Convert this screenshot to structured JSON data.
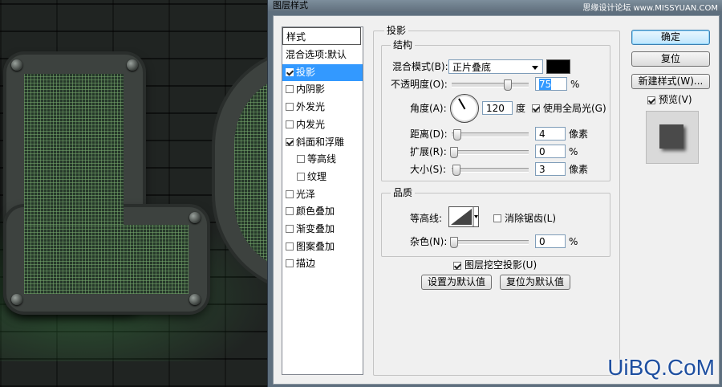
{
  "window": {
    "title": "图层样式",
    "watermark": "思缘设计论坛 www.MISSYUAN.COM"
  },
  "style_list": {
    "header": "样式",
    "items": [
      {
        "label": "混合选项:默认",
        "checkbox": false,
        "checked": false,
        "selected": false,
        "indent": 0
      },
      {
        "label": "投影",
        "checkbox": true,
        "checked": true,
        "selected": true,
        "indent": 0
      },
      {
        "label": "内阴影",
        "checkbox": true,
        "checked": false,
        "selected": false,
        "indent": 0
      },
      {
        "label": "外发光",
        "checkbox": true,
        "checked": false,
        "selected": false,
        "indent": 0
      },
      {
        "label": "内发光",
        "checkbox": true,
        "checked": false,
        "selected": false,
        "indent": 0
      },
      {
        "label": "斜面和浮雕",
        "checkbox": true,
        "checked": true,
        "selected": false,
        "indent": 0
      },
      {
        "label": "等高线",
        "checkbox": true,
        "checked": false,
        "selected": false,
        "indent": 1
      },
      {
        "label": "纹理",
        "checkbox": true,
        "checked": false,
        "selected": false,
        "indent": 1
      },
      {
        "label": "光泽",
        "checkbox": true,
        "checked": false,
        "selected": false,
        "indent": 0
      },
      {
        "label": "颜色叠加",
        "checkbox": true,
        "checked": false,
        "selected": false,
        "indent": 0
      },
      {
        "label": "渐变叠加",
        "checkbox": true,
        "checked": false,
        "selected": false,
        "indent": 0
      },
      {
        "label": "图案叠加",
        "checkbox": true,
        "checked": false,
        "selected": false,
        "indent": 0
      },
      {
        "label": "描边",
        "checkbox": true,
        "checked": false,
        "selected": false,
        "indent": 0
      }
    ]
  },
  "drop_shadow": {
    "section_title": "投影",
    "structure": {
      "title": "结构",
      "blend_mode_label": "混合模式(B):",
      "blend_mode_value": "正片叠底",
      "shadow_color": "#000000",
      "opacity_label": "不透明度(O):",
      "opacity_value": "75",
      "opacity_fraction": 0.75,
      "percent": "%",
      "angle_label": "角度(A):",
      "angle_value": "120",
      "angle_unit": "度",
      "global_light_label": "使用全局光(G)",
      "global_light_checked": true,
      "distance_label": "距离(D):",
      "distance_value": "4",
      "pixel_unit": "像素",
      "spread_label": "扩展(R):",
      "spread_value": "0",
      "size_label": "大小(S):",
      "size_value": "3"
    },
    "quality": {
      "title": "品质",
      "contour_label": "等高线:",
      "anti_alias_label": "消除锯齿(L)",
      "anti_alias_checked": false,
      "noise_label": "杂色(N):",
      "noise_value": "0"
    },
    "knockout_label": "图层挖空投影(U)",
    "knockout_checked": true,
    "make_default_label": "设置为默认值",
    "reset_default_label": "复位为默认值"
  },
  "buttons": {
    "ok": "确定",
    "reset": "复位",
    "new_style": "新建样式(W)...",
    "preview_label": "预览(V)",
    "preview_checked": true
  },
  "brand": "UiBQ.CoM"
}
